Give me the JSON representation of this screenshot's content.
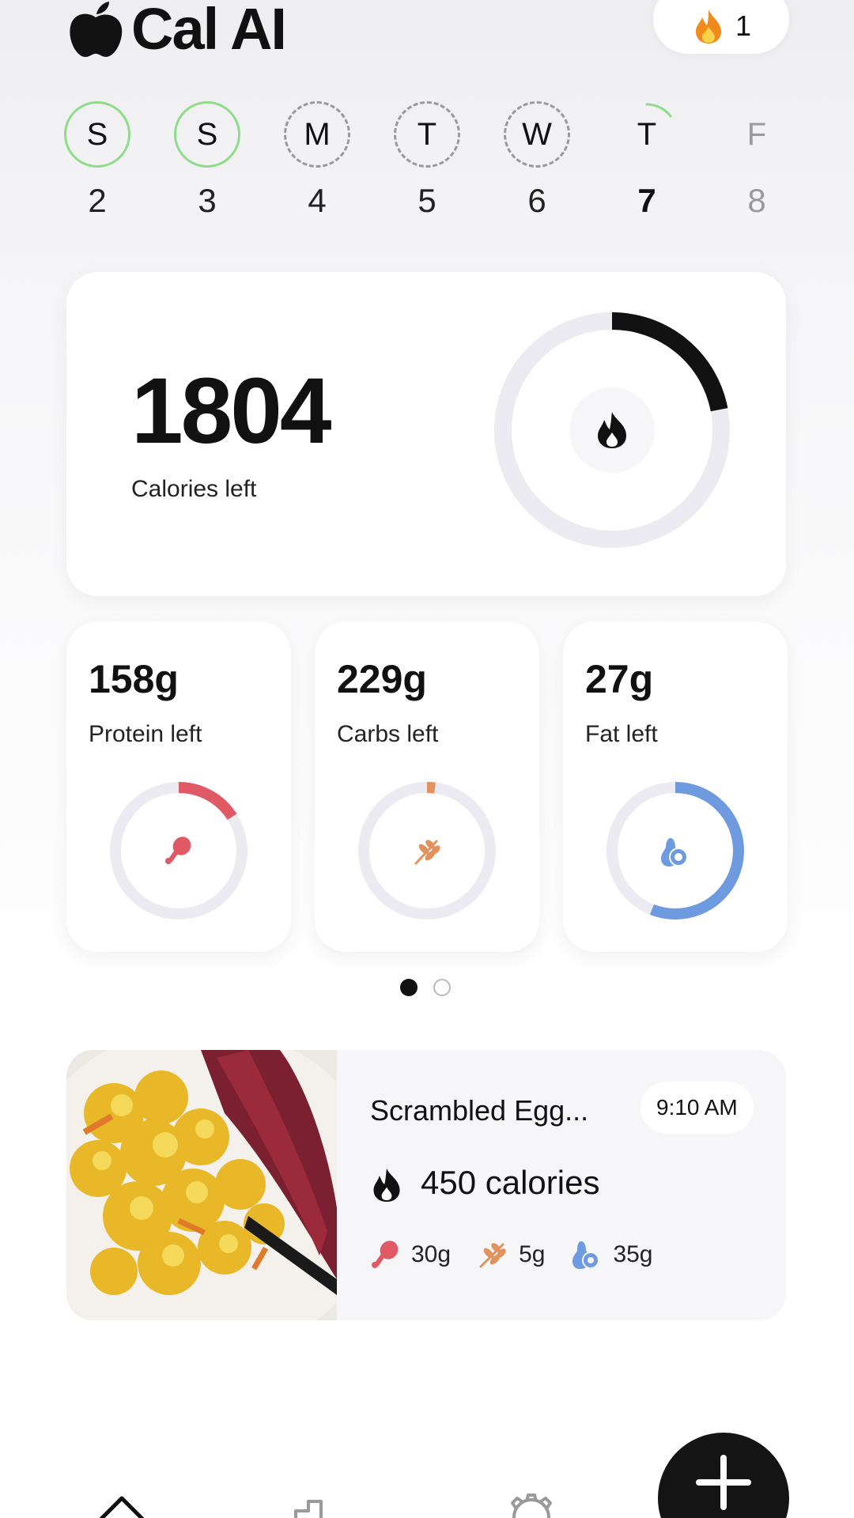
{
  "header": {
    "app_title": "Cal AI",
    "logo_icon": "apple-icon",
    "streak_icon": "flame-icon",
    "streak_count": "1"
  },
  "week": [
    {
      "letter": "S",
      "date": "2",
      "state": "done"
    },
    {
      "letter": "S",
      "date": "3",
      "state": "done"
    },
    {
      "letter": "M",
      "date": "4",
      "state": "empty"
    },
    {
      "letter": "T",
      "date": "5",
      "state": "empty"
    },
    {
      "letter": "W",
      "date": "6",
      "state": "empty"
    },
    {
      "letter": "T",
      "date": "7",
      "state": "today"
    },
    {
      "letter": "F",
      "date": "8",
      "state": "future"
    }
  ],
  "calories": {
    "value": "1804",
    "label": "Calories left",
    "progress": 0.22,
    "icon": "flame-icon"
  },
  "macros": [
    {
      "value": "158g",
      "label": "Protein left",
      "progress": 0.16,
      "color": "#e05a66",
      "icon": "drumstick-icon"
    },
    {
      "value": "229g",
      "label": "Carbs left",
      "progress": 0.02,
      "color": "#e2925c",
      "icon": "wheat-icon"
    },
    {
      "value": "27g",
      "label": "Fat left",
      "progress": 0.56,
      "color": "#6e9ae0",
      "icon": "avocado-icon"
    }
  ],
  "pager": {
    "count": 2,
    "active": 0
  },
  "meal": {
    "name": "Scrambled Egg...",
    "time": "9:10 AM",
    "calories": "450 calories",
    "protein": "30g",
    "carbs": "5g",
    "fat": "35g",
    "photo": "scrambled-eggs-photo"
  },
  "nav": {
    "items": [
      "home-icon",
      "progress-icon",
      "settings-icon"
    ],
    "fab_icon": "plus-icon"
  },
  "colors": {
    "accent": "#111111",
    "ring_track": "#ebebf1",
    "done_green": "#8fdc8a",
    "protein": "#e05a66",
    "carbs": "#e2925c",
    "fat": "#6e9ae0",
    "streak_orange": "#f08a1c"
  }
}
